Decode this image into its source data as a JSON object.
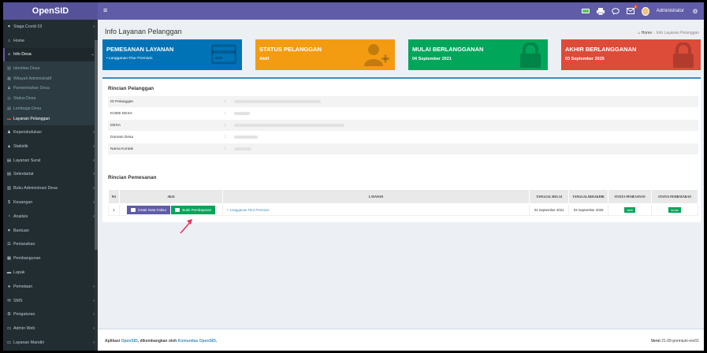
{
  "app": {
    "logo": "OpenSID",
    "hamburger": "≡"
  },
  "topbar": {
    "admin_name": "Administrator",
    "notif_count": "1"
  },
  "sidebar": {
    "items_top": [
      {
        "label": "Siaga Covid-19",
        "icon": "heart-icon",
        "glyph": "♥",
        "chevron": "‹"
      },
      {
        "label": "Home",
        "icon": "home-icon",
        "glyph": "⌂",
        "chevron": ""
      },
      {
        "label": "Info Desa",
        "icon": "home-icon",
        "glyph": "⌂",
        "chevron": "⌄"
      }
    ],
    "sub_items": [
      {
        "label": "Identitas Desa",
        "glyph": "▤"
      },
      {
        "label": "Wilayah Administratif",
        "glyph": "▦"
      },
      {
        "label": "Pemerintahan Desa",
        "glyph": "♟"
      },
      {
        "label": "Status Desa",
        "glyph": "◎"
      },
      {
        "label": "Lembaga Desa",
        "glyph": "▤"
      },
      {
        "label": "Layanan Pelanggan",
        "glyph": "▬"
      }
    ],
    "items_bottom": [
      {
        "label": "Kependudukan",
        "glyph": "♟",
        "chevron": "‹"
      },
      {
        "label": "Statistik",
        "glyph": "▲",
        "chevron": "‹"
      },
      {
        "label": "Layanan Surat",
        "glyph": "▤",
        "chevron": "‹"
      },
      {
        "label": "Sekretariat",
        "glyph": "▤",
        "chevron": "‹"
      },
      {
        "label": "Buku Administrasi Desa",
        "glyph": "▥",
        "chevron": "‹"
      },
      {
        "label": "Keuangan",
        "glyph": "$",
        "chevron": "‹"
      },
      {
        "label": "Analisis",
        "glyph": "◔",
        "chevron": "‹"
      },
      {
        "label": "Bantuan",
        "glyph": "♥",
        "chevron": ""
      },
      {
        "label": "Pertanahan",
        "glyph": "☰",
        "chevron": ""
      },
      {
        "label": "Pembangunan",
        "glyph": "▦",
        "chevron": ""
      },
      {
        "label": "Lapak",
        "glyph": "▬",
        "chevron": ""
      },
      {
        "label": "Pemetaan",
        "glyph": "●",
        "chevron": "‹"
      },
      {
        "label": "SMS",
        "glyph": "✉",
        "chevron": "‹"
      },
      {
        "label": "Pengaturan",
        "glyph": "⚙",
        "chevron": "‹"
      },
      {
        "label": "Admin Web",
        "glyph": "▭",
        "chevron": "‹"
      },
      {
        "label": "Layanan Mandiri",
        "glyph": "▭",
        "chevron": "‹"
      }
    ]
  },
  "page": {
    "title": "Info Layanan Pelanggan",
    "crumb_home": "Home",
    "crumb_sep": "›",
    "crumb_current": "Info Layanan Pelanggan"
  },
  "boxes": [
    {
      "title": "PEMESANAN LAYANAN",
      "value": "•   Langganan Fitur Premium",
      "color": "#0073b7"
    },
    {
      "title": "STATUS PELANGGAN",
      "value": "Aktif",
      "color": "#f39c12"
    },
    {
      "title": "MULAI BERLANGGANAN",
      "value": "04 September 2021",
      "color": "#00a65a"
    },
    {
      "title": "AKHIR BERLANGGANAN",
      "value": "03 September 2025",
      "color": "#dd4b39"
    }
  ],
  "rincian_pelanggan": {
    "title": "Rincian Pelanggan",
    "rows": [
      {
        "label": "ID Pelanggan",
        "colon": ":"
      },
      {
        "label": "KODE DESA",
        "colon": ":"
      },
      {
        "label": "DESA",
        "colon": ":"
      },
      {
        "label": "Domain Desa",
        "colon": ":"
      },
      {
        "label": "Nama Kontak",
        "colon": ":"
      }
    ]
  },
  "rincian_pemesanan": {
    "title": "Rincian Pemesanan",
    "headers": [
      "NO",
      "AKSI",
      "LAYANAN",
      "TANGGAL MULAI",
      "TANGGAL BERAKHIR",
      "STATUS PEMESANAN",
      "STATUS PEMBAYARAN"
    ],
    "row": {
      "no": "1",
      "btn_print": "Cetak Nota Faktur",
      "btn_proof": "Bukti Pembayaran",
      "layanan": "Langganan Fitur Premium",
      "mulai": "04 September 2021",
      "berakhir": "03 September 2025",
      "status_pesan": "aktif",
      "status_bayar": "lunas"
    }
  },
  "footer": {
    "prefix": "Aplikasi ",
    "app_link": "OpenSID",
    "middle": ", dikembangkan oleh ",
    "community_link": "Komunitas OpenSID",
    "suffix": ".",
    "version_label": "Versi",
    "version": "21.09-premium-rev01"
  }
}
